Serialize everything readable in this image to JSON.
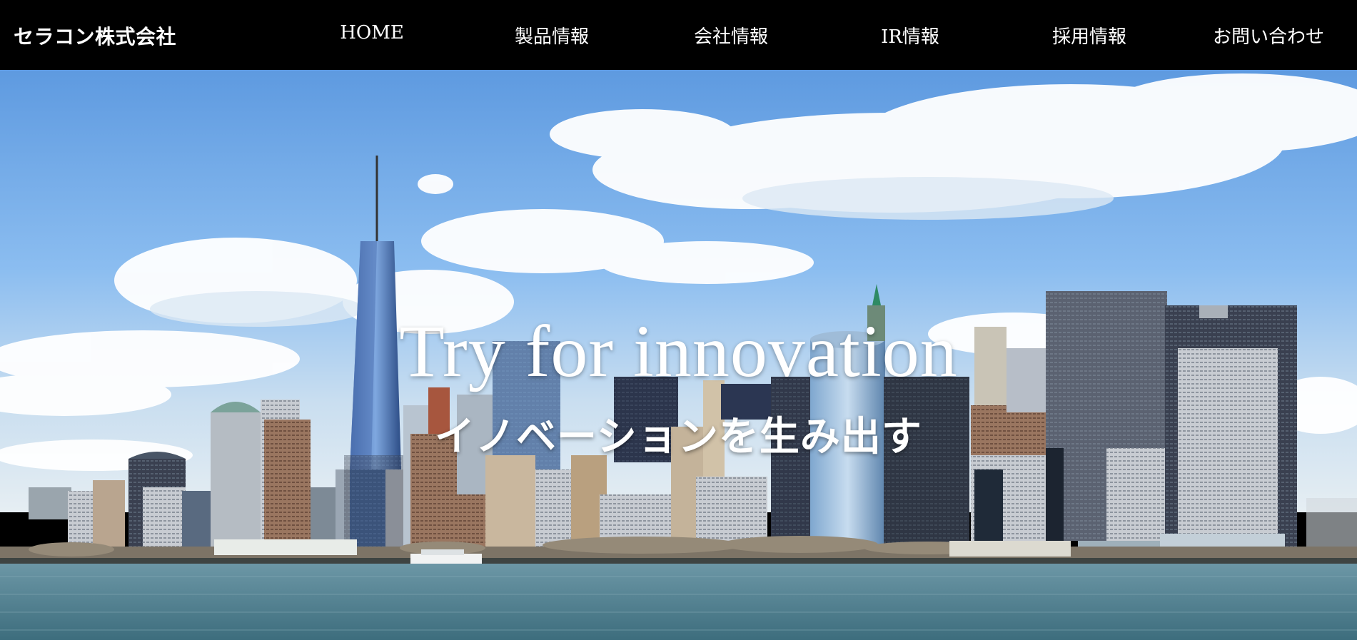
{
  "header": {
    "brand": "セラコン株式会社",
    "nav": [
      {
        "label": "HOME"
      },
      {
        "label": "製品情報"
      },
      {
        "label": "会社情報"
      },
      {
        "label": "IR情報"
      },
      {
        "label": "採用情報"
      },
      {
        "label": "お問い合わせ"
      }
    ]
  },
  "hero": {
    "title": "Try for innovation",
    "subtitle": "イノベーションを生み出す",
    "image": "city-skyline-photo"
  },
  "colors": {
    "header_bg": "#000000",
    "text": "#ffffff",
    "sky": "#6aa6e6",
    "water": "#4f7f8f"
  }
}
